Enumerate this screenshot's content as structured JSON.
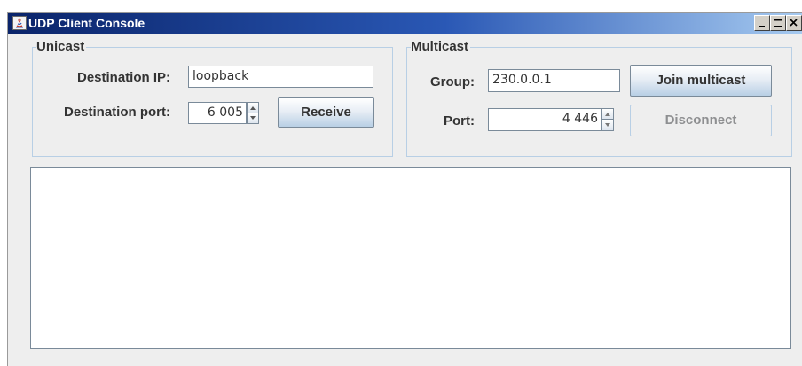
{
  "window": {
    "title": "UDP Client Console",
    "icons": {
      "app": "java-icon",
      "minimize": "minimize-icon",
      "maximize": "maximize-icon",
      "close": "close-icon"
    }
  },
  "unicast": {
    "legend": "Unicast",
    "destination_ip_label": "Destination IP:",
    "destination_ip_value": "loopback",
    "destination_port_label": "Destination port:",
    "destination_port_value": "6 005",
    "receive_label": "Receive"
  },
  "multicast": {
    "legend": "Multicast",
    "group_label": "Group:",
    "group_value": "230.0.0.1",
    "port_label": "Port:",
    "port_value": "4 446",
    "join_label": "Join multicast",
    "disconnect_label": "Disconnect",
    "disconnect_enabled": false
  },
  "output": {
    "text": ""
  },
  "colors": {
    "titlebar_start": "#0a246a",
    "titlebar_end": "#a6caf0",
    "panel_background": "#eeeeee",
    "group_border": "#b8cfe5",
    "label_text": "#333333",
    "disabled_text": "#8e8f91"
  }
}
